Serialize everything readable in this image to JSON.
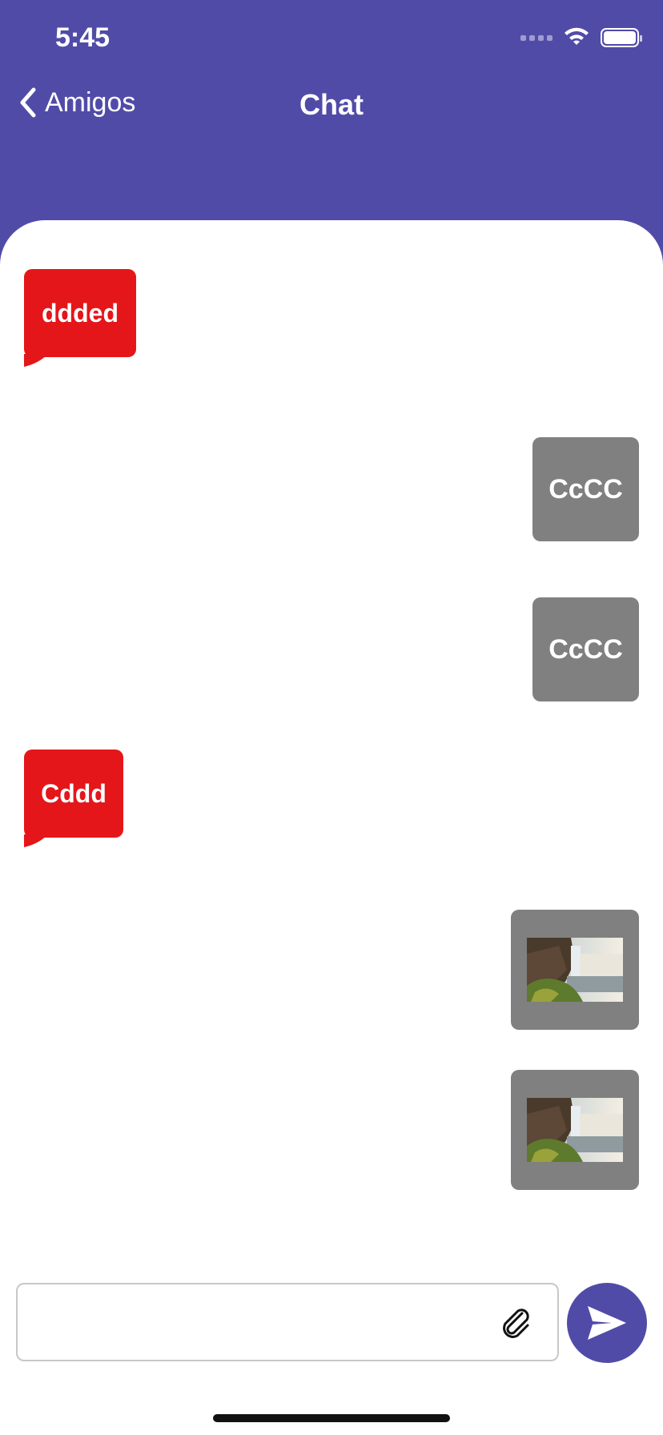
{
  "status_bar": {
    "time": "5:45"
  },
  "nav": {
    "back_label": "Amigos",
    "title": "Chat"
  },
  "messages": [
    {
      "side": "incoming",
      "type": "text",
      "text": "ddded"
    },
    {
      "side": "outgoing",
      "type": "text",
      "text": "CcCC"
    },
    {
      "side": "outgoing",
      "type": "text",
      "text": "CcCC"
    },
    {
      "side": "incoming",
      "type": "text",
      "text": "Cddd"
    },
    {
      "side": "outgoing",
      "type": "image",
      "image": "waterfall-photo"
    },
    {
      "side": "outgoing",
      "type": "image",
      "image": "waterfall-photo"
    }
  ],
  "composer": {
    "value": "",
    "placeholder": ""
  },
  "icons": {
    "back": "chevron-left-icon",
    "attach": "paperclip-icon",
    "send": "paper-plane-icon",
    "wifi": "wifi-icon",
    "battery": "battery-icon",
    "signal": "signal-icon"
  },
  "colors": {
    "header": "#514BA8",
    "incoming_bubble": "#E4161A",
    "outgoing_bubble": "#808080",
    "send_button": "#514BA8"
  }
}
